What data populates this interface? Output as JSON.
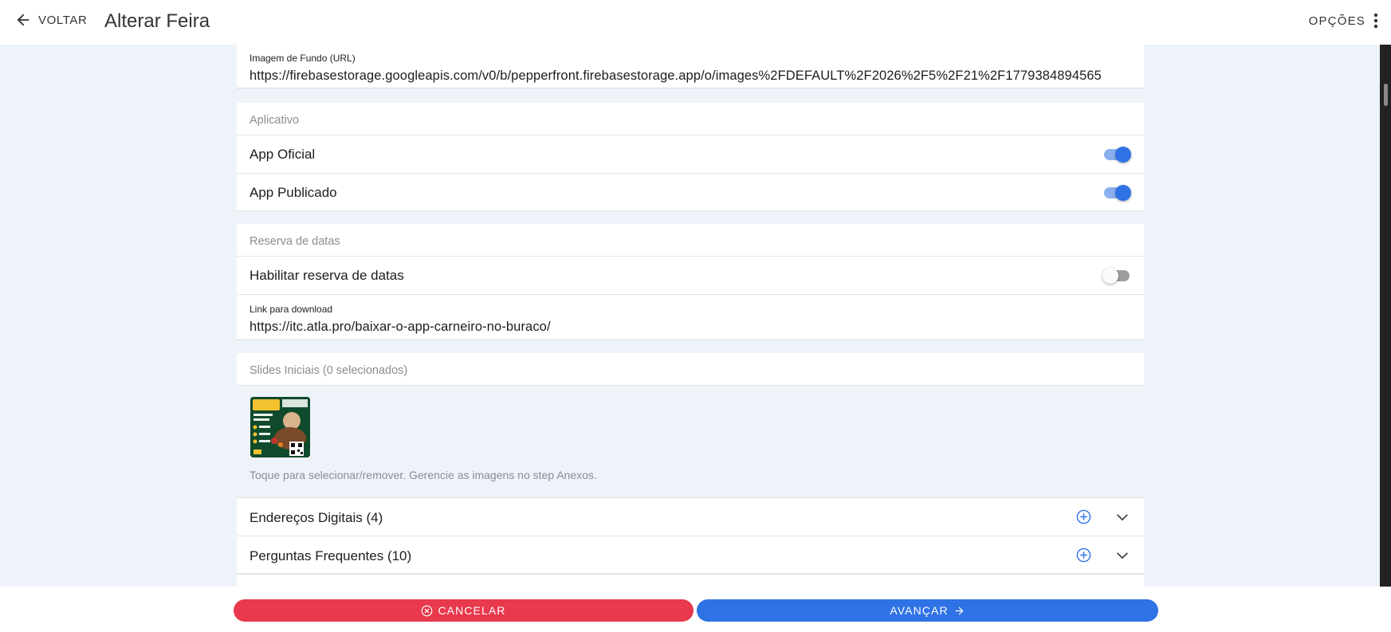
{
  "header": {
    "back_label": "VOLTAR",
    "title": "Alterar Feira",
    "options_label": "OPÇÕES"
  },
  "background_image": {
    "label": "Imagem de Fundo (URL)",
    "value": "https://firebasestorage.googleapis.com/v0/b/pepperfront.firebasestorage.app/o/images%2FDEFAULT%2F2026%2F5%2F21%2F1779384894565"
  },
  "app_section": {
    "header": "Aplicativo",
    "rows": [
      {
        "label": "App Oficial",
        "enabled": true
      },
      {
        "label": "App Publicado",
        "enabled": true
      }
    ]
  },
  "reservation_section": {
    "header": "Reserva de datas",
    "toggle_label": "Habilitar reserva de datas",
    "toggle_enabled": false,
    "download_label": "Link para download",
    "download_value": "https://itc.atla.pro/baixar-o-app-carneiro-no-buraco/"
  },
  "slides_section": {
    "header": "Slides Iniciais (0 selecionados)",
    "hint": "Toque para selecionar/remover. Gerencie as imagens no step Anexos."
  },
  "accordions": [
    {
      "label": "Endereços Digitais (4)"
    },
    {
      "label": "Perguntas Frequentes (10)"
    }
  ],
  "footer": {
    "cancel_label": "CANCELAR",
    "next_label": "AVANÇAR"
  },
  "colors": {
    "primary": "#2f72e6",
    "danger": "#e8394d",
    "page_background": "#eef3fa"
  }
}
